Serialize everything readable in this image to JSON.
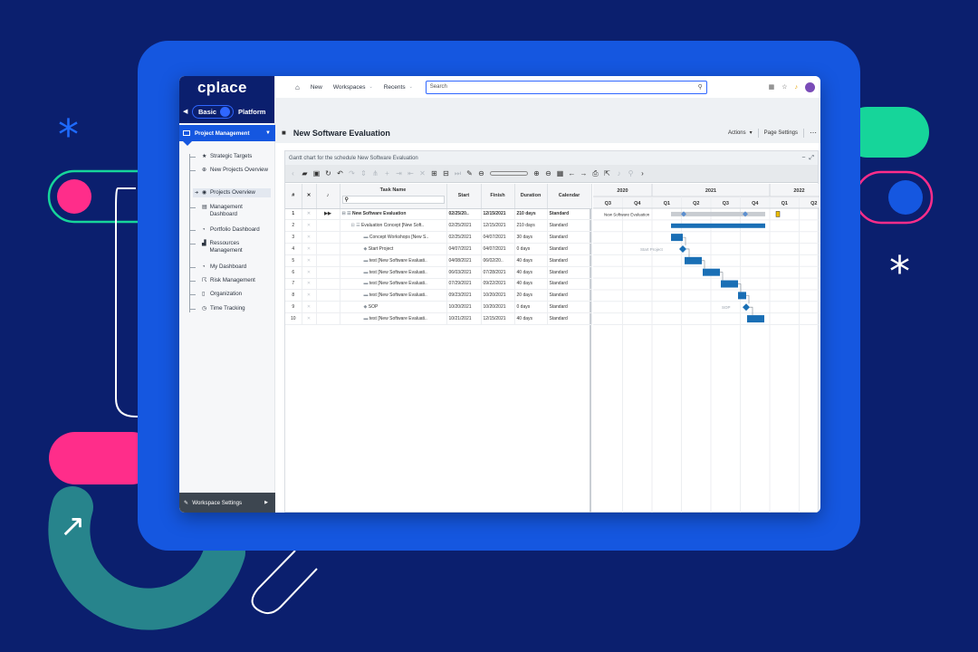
{
  "brand": {
    "logo": "cplace",
    "mode_left": "Basic",
    "mode_right": "Platform"
  },
  "sidebar": {
    "section": "Project Management",
    "items": [
      {
        "label": "Strategic Targets",
        "icon": "star-icon"
      },
      {
        "label": "New Projects Overview",
        "icon": "plus-circle-icon"
      },
      {
        "label": "Projects Overview",
        "icon": "globe-icon"
      },
      {
        "label": "Management Dashboard",
        "icon": "dashboard-icon"
      },
      {
        "label": "Portfolio Dashboard",
        "icon": "gauge-icon"
      },
      {
        "label": "Ressources Management",
        "icon": "chart-icon"
      },
      {
        "label": "My Dashboard",
        "icon": "gauge-icon"
      },
      {
        "label": "Risk Management",
        "icon": "risk-icon"
      },
      {
        "label": "Organization",
        "icon": "org-icon"
      },
      {
        "label": "Time Tracking",
        "icon": "clock-icon"
      }
    ],
    "footer": "Workspace Settings"
  },
  "topbar": {
    "new": "New",
    "workspaces": "Workspaces",
    "recents": "Recents",
    "search_placeholder": "Search"
  },
  "page": {
    "title": "New Software Evaluation",
    "actions": "Actions",
    "page_settings": "Page Settings"
  },
  "panel": {
    "title": "Gantt chart for the schedule New Software Evaluation"
  },
  "table": {
    "headers": [
      "#",
      "",
      "",
      "Task Name",
      "Start",
      "Finish",
      "Duration",
      "Calendar"
    ],
    "rows": [
      {
        "n": "1",
        "name": "New Software Evaluation",
        "start": "02/25/20..",
        "finish": "12/15/2021",
        "dur": "210 days",
        "cal": "Standard",
        "bold": true,
        "indent": 0
      },
      {
        "n": "2",
        "name": "Evaluation Concept [New Soft..",
        "start": "02/25/2021",
        "finish": "12/15/2021",
        "dur": "210 days",
        "cal": "Standard",
        "bold": false,
        "indent": 1
      },
      {
        "n": "3",
        "name": "Concept Workshops [New S..",
        "start": "02/25/2021",
        "finish": "04/07/2021",
        "dur": "30 days",
        "cal": "Standard",
        "bold": false,
        "indent": 2
      },
      {
        "n": "4",
        "name": "Start Project",
        "start": "04/07/2021",
        "finish": "04/07/2021",
        "dur": "0 days",
        "cal": "Standard",
        "bold": false,
        "indent": 2
      },
      {
        "n": "5",
        "name": "test [New Software Evaluati..",
        "start": "04/08/2021",
        "finish": "06/02/20..",
        "dur": "40 days",
        "cal": "Standard",
        "bold": false,
        "indent": 2
      },
      {
        "n": "6",
        "name": "test [New Software Evaluati..",
        "start": "06/03/2021",
        "finish": "07/28/2021",
        "dur": "40 days",
        "cal": "Standard",
        "bold": false,
        "indent": 2
      },
      {
        "n": "7",
        "name": "test [New Software Evaluati..",
        "start": "07/29/2021",
        "finish": "09/22/2021",
        "dur": "40 days",
        "cal": "Standard",
        "bold": false,
        "indent": 2
      },
      {
        "n": "8",
        "name": "test [New Software Evaluati..",
        "start": "09/23/2021",
        "finish": "10/20/2021",
        "dur": "20 days",
        "cal": "Standard",
        "bold": false,
        "indent": 2
      },
      {
        "n": "9",
        "name": "SOP",
        "start": "10/20/2021",
        "finish": "10/20/2021",
        "dur": "0 days",
        "cal": "Standard",
        "bold": false,
        "indent": 2
      },
      {
        "n": "10",
        "name": "test [New Software Evaluati..",
        "start": "10/21/2021",
        "finish": "12/15/2021",
        "dur": "40 days",
        "cal": "Standard",
        "bold": false,
        "indent": 2
      }
    ]
  },
  "gantt": {
    "years": [
      "2020",
      "2021",
      "2022"
    ],
    "quarters": [
      "Q3",
      "Q4",
      "Q1",
      "Q2",
      "Q3",
      "Q4",
      "Q1",
      "Q2"
    ],
    "summary_label": "New Software Evaluation",
    "milestone_labels": [
      "Start Project",
      "SOP"
    ],
    "bar_color": "#1a6fb5"
  }
}
